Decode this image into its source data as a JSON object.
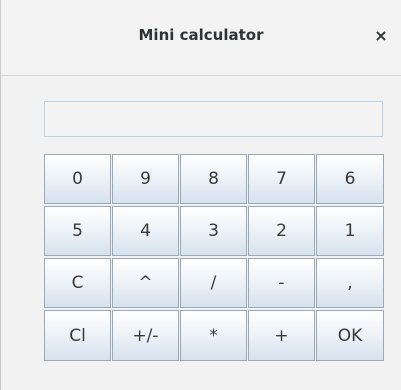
{
  "window": {
    "title": "Mini calculator",
    "close_label": "×"
  },
  "display": {
    "value": ""
  },
  "keys": [
    "0",
    "9",
    "8",
    "7",
    "6",
    "5",
    "4",
    "3",
    "2",
    "1",
    "C",
    "^",
    "/",
    "-",
    ",",
    "Cl",
    "+/-",
    "*",
    "+",
    "OK"
  ]
}
